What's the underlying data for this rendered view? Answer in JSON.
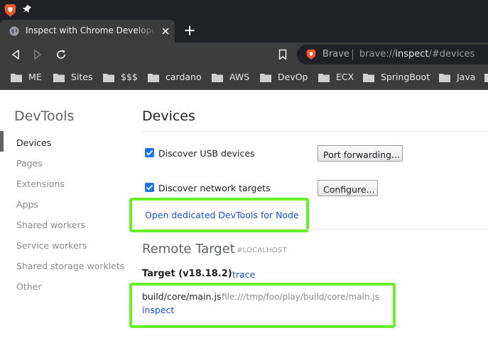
{
  "browser": {
    "tab": {
      "title": "Inspect with Chrome Developer Tools"
    },
    "address": {
      "brand": "Brave",
      "scheme": "brave://",
      "host": "inspect",
      "path": "/#devices"
    },
    "bookmarks": [
      "ME",
      "Sites",
      "$$$",
      "cardano",
      "AWS",
      "DevOp",
      "ECX",
      "SpringBoot",
      "Java"
    ]
  },
  "sidebar": {
    "title": "DevTools",
    "items": [
      {
        "label": "Devices"
      },
      {
        "label": "Pages"
      },
      {
        "label": "Extensions"
      },
      {
        "label": "Apps"
      },
      {
        "label": "Shared workers"
      },
      {
        "label": "Service workers"
      },
      {
        "label": "Shared storage worklets"
      },
      {
        "label": "Other"
      }
    ]
  },
  "devices": {
    "title": "Devices",
    "usb": {
      "label": "Discover USB devices",
      "checked": true,
      "button": "Port forwarding..."
    },
    "network": {
      "label": "Discover network targets",
      "checked": true,
      "button": "Configure..."
    },
    "node_link": "Open dedicated DevTools for Node"
  },
  "remote": {
    "title": "Remote Target",
    "subtitle": "#LOCALHOST",
    "target": {
      "name": "Target (v18.18.2)",
      "trace_link": "trace",
      "file": "build/core/main.js",
      "url": "file:///tmp/foo/play/build/core/main.js",
      "inspect_link": "inspect"
    }
  },
  "colors": {
    "highlight": "#66f02a",
    "link": "#1a4fbd",
    "checkbox": "#1a73e8"
  }
}
